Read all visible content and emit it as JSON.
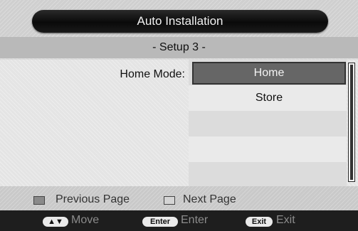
{
  "header": {
    "title": "Auto Installation"
  },
  "step": {
    "label": "- Setup 3 -"
  },
  "setting": {
    "label": "Home Mode:",
    "options": [
      "Home",
      "Store"
    ],
    "selected_index": 0
  },
  "legend": {
    "previous": "Previous Page",
    "next": "Next Page"
  },
  "controls": [
    {
      "key": "▲▼",
      "action": "Move"
    },
    {
      "key": "Enter",
      "action": "Enter"
    },
    {
      "key": "Exit",
      "action": "Exit"
    }
  ],
  "colors": {
    "selected_bg": "#666666",
    "prev_swatch": "#8a8a8a",
    "next_swatch": "#d4d4d4"
  }
}
